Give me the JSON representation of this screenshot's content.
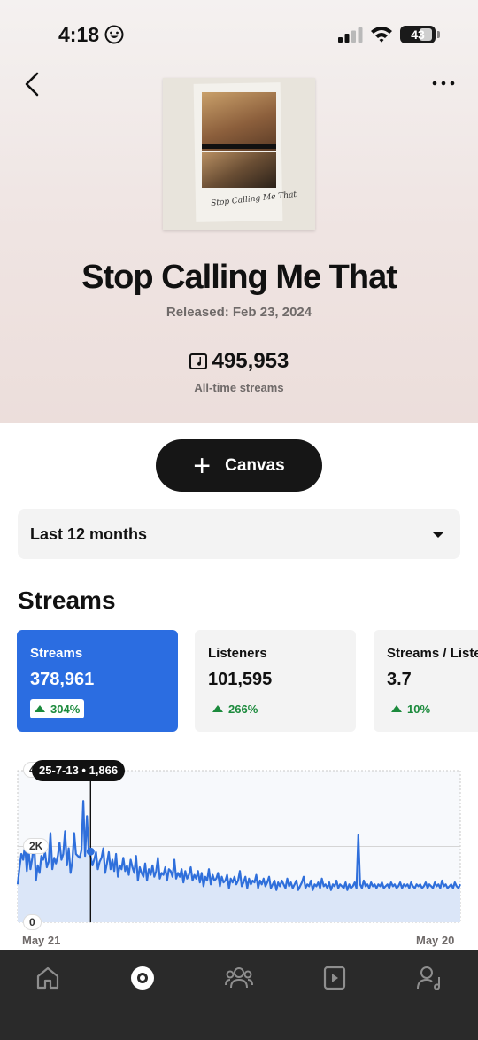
{
  "status": {
    "time": "4:18",
    "battery": "43"
  },
  "track": {
    "title": "Stop Calling Me That",
    "release": "Released: Feb 23, 2024",
    "cover_signature": "Stop Calling Me That",
    "total_streams": "495,953",
    "total_streams_label": "All-time streams"
  },
  "actions": {
    "canvas_label": "Canvas"
  },
  "period": {
    "selected": "Last 12 months"
  },
  "section": {
    "title": "Streams"
  },
  "metrics": [
    {
      "label": "Streams",
      "value": "378,961",
      "change": "304%"
    },
    {
      "label": "Listeners",
      "value": "101,595",
      "change": "266%"
    },
    {
      "label": "Streams / Listeners",
      "value": "3.7",
      "change": "10%"
    }
  ],
  "chart_data": {
    "type": "area",
    "tooltip": "25-7-13 • 1,866",
    "y_ticks": [
      "0",
      "2K",
      "4K"
    ],
    "x_start_label": "May 21",
    "x_end_label": "May 20",
    "ylim": [
      0,
      4000
    ],
    "highlight": {
      "x": "25-7-13",
      "y": 1866
    },
    "color": "#2f6fdb",
    "fill": "#dbe6f8",
    "values": [
      1000,
      1450,
      1800,
      1650,
      2050,
      1350,
      1900,
      1400,
      1700,
      2150,
      1100,
      1500,
      1300,
      1750,
      1650,
      1850,
      1450,
      1600,
      2350,
      1400,
      1700,
      1550,
      1750,
      2100,
      1650,
      1800,
      2400,
      1500,
      1950,
      1300,
      1600,
      2350,
      1800,
      1750,
      1700,
      1900,
      3200,
      1750,
      2800,
      1900,
      1750,
      1500,
      1650,
      1850,
      1400,
      1600,
      1700,
      1950,
      1300,
      1550,
      1850,
      1400,
      1650,
      1350,
      1800,
      1200,
      1500,
      1400,
      1700,
      1350,
      1500,
      1250,
      1650,
      1450,
      1300,
      1750,
      1100,
      1450,
      1300,
      1200,
      1550,
      1100,
      1400,
      1250,
      1500,
      1200,
      1350,
      1700,
      1150,
      1300,
      1250,
      1450,
      1100,
      1400,
      1350,
      1200,
      1650,
      1150,
      1300,
      1200,
      1400,
      1050,
      1350,
      1150,
      1250,
      1450,
      1100,
      1250,
      1150,
      1350,
      1050,
      1300,
      950,
      1200,
      1100,
      1400,
      1000,
      1250,
      1100,
      1150,
      1300,
      950,
      1200,
      1050,
      1100,
      1250,
      900,
      1150,
      1050,
      1200,
      1000,
      1100,
      1350,
      950,
      1050,
      1200,
      900,
      1150,
      1000,
      1100,
      1050,
      1250,
      900,
      1100,
      1000,
      1150,
      950,
      1050,
      1200,
      900,
      1000,
      1100,
      850,
      1050,
      950,
      1100,
      1000,
      900,
      1150,
      950,
      1050,
      900,
      1000,
      1100,
      850,
      950,
      1050,
      1200,
      900,
      1000,
      950,
      1100,
      850,
      1000,
      950,
      1050,
      900,
      1150,
      950,
      1000,
      900,
      1050,
      850,
      1000,
      950,
      1100,
      900,
      1000,
      950,
      900,
      1050,
      850,
      1000,
      900,
      950,
      1050,
      900,
      2300,
      1000,
      900,
      1100,
      950,
      1000,
      900,
      1050,
      950,
      1000,
      900,
      1000,
      950,
      1050,
      900,
      950,
      1000,
      900,
      1050,
      950,
      1000,
      900,
      950,
      1050,
      900,
      1000,
      950,
      1000,
      900,
      1050,
      950,
      900,
      1000,
      950,
      1000,
      900,
      950,
      1050,
      900,
      1000,
      950,
      900,
      1050,
      950,
      1000,
      900,
      1100,
      950,
      1000,
      900,
      950,
      1000,
      900,
      1050,
      950,
      900,
      1000
    ]
  }
}
